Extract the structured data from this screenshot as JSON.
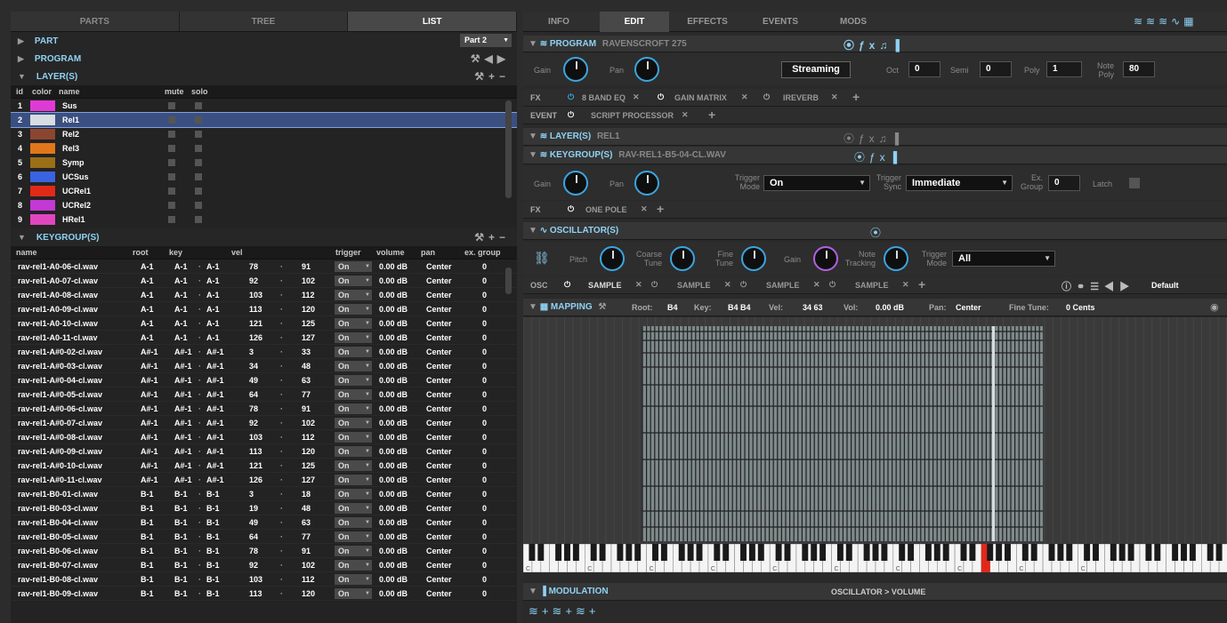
{
  "left_tabs": [
    "PARTS",
    "TREE",
    "LIST"
  ],
  "part": {
    "label": "PART",
    "selector": "Part 2"
  },
  "program_label": "PROGRAM",
  "layers": {
    "label": "LAYER(S)",
    "headers": [
      "id",
      "color",
      "name",
      "mute",
      "solo"
    ],
    "rows": [
      {
        "id": "1",
        "name": "Sus",
        "color": "#e03ad6"
      },
      {
        "id": "2",
        "name": "Rel1",
        "color": "#d7dde0"
      },
      {
        "id": "3",
        "name": "Rel2",
        "color": "#8a4630"
      },
      {
        "id": "4",
        "name": "Rel3",
        "color": "#e2761a"
      },
      {
        "id": "5",
        "name": "Symp",
        "color": "#9b6f15"
      },
      {
        "id": "6",
        "name": "UCSus",
        "color": "#3a63e0"
      },
      {
        "id": "7",
        "name": "UCRel1",
        "color": "#e02a18"
      },
      {
        "id": "8",
        "name": "UCRel2",
        "color": "#c438d4"
      },
      {
        "id": "9",
        "name": "HRel1",
        "color": "#e046c0"
      }
    ]
  },
  "keygroups": {
    "label": "KEYGROUP(S)",
    "headers": [
      "name",
      "root",
      "key",
      "vel",
      "trigger",
      "volume",
      "pan",
      "ex. group"
    ],
    "rows": [
      [
        "rav-rel1-A0-06-cl.wav",
        "A-1",
        "A-1",
        "A-1",
        "78",
        "91",
        "On",
        "0.00 dB",
        "Center",
        "0"
      ],
      [
        "rav-rel1-A0-07-cl.wav",
        "A-1",
        "A-1",
        "A-1",
        "92",
        "102",
        "On",
        "0.00 dB",
        "Center",
        "0"
      ],
      [
        "rav-rel1-A0-08-cl.wav",
        "A-1",
        "A-1",
        "A-1",
        "103",
        "112",
        "On",
        "0.00 dB",
        "Center",
        "0"
      ],
      [
        "rav-rel1-A0-09-cl.wav",
        "A-1",
        "A-1",
        "A-1",
        "113",
        "120",
        "On",
        "0.00 dB",
        "Center",
        "0"
      ],
      [
        "rav-rel1-A0-10-cl.wav",
        "A-1",
        "A-1",
        "A-1",
        "121",
        "125",
        "On",
        "0.00 dB",
        "Center",
        "0"
      ],
      [
        "rav-rel1-A0-11-cl.wav",
        "A-1",
        "A-1",
        "A-1",
        "126",
        "127",
        "On",
        "0.00 dB",
        "Center",
        "0"
      ],
      [
        "rav-rel1-A#0-02-cl.wav",
        "A#-1",
        "A#-1",
        "A#-1",
        "3",
        "33",
        "On",
        "0.00 dB",
        "Center",
        "0"
      ],
      [
        "rav-rel1-A#0-03-cl.wav",
        "A#-1",
        "A#-1",
        "A#-1",
        "34",
        "48",
        "On",
        "0.00 dB",
        "Center",
        "0"
      ],
      [
        "rav-rel1-A#0-04-cl.wav",
        "A#-1",
        "A#-1",
        "A#-1",
        "49",
        "63",
        "On",
        "0.00 dB",
        "Center",
        "0"
      ],
      [
        "rav-rel1-A#0-05-cl.wav",
        "A#-1",
        "A#-1",
        "A#-1",
        "64",
        "77",
        "On",
        "0.00 dB",
        "Center",
        "0"
      ],
      [
        "rav-rel1-A#0-06-cl.wav",
        "A#-1",
        "A#-1",
        "A#-1",
        "78",
        "91",
        "On",
        "0.00 dB",
        "Center",
        "0"
      ],
      [
        "rav-rel1-A#0-07-cl.wav",
        "A#-1",
        "A#-1",
        "A#-1",
        "92",
        "102",
        "On",
        "0.00 dB",
        "Center",
        "0"
      ],
      [
        "rav-rel1-A#0-08-cl.wav",
        "A#-1",
        "A#-1",
        "A#-1",
        "103",
        "112",
        "On",
        "0.00 dB",
        "Center",
        "0"
      ],
      [
        "rav-rel1-A#0-09-cl.wav",
        "A#-1",
        "A#-1",
        "A#-1",
        "113",
        "120",
        "On",
        "0.00 dB",
        "Center",
        "0"
      ],
      [
        "rav-rel1-A#0-10-cl.wav",
        "A#-1",
        "A#-1",
        "A#-1",
        "121",
        "125",
        "On",
        "0.00 dB",
        "Center",
        "0"
      ],
      [
        "rav-rel1-A#0-11-cl.wav",
        "A#-1",
        "A#-1",
        "A#-1",
        "126",
        "127",
        "On",
        "0.00 dB",
        "Center",
        "0"
      ],
      [
        "rav-rel1-B0-01-cl.wav",
        "B-1",
        "B-1",
        "B-1",
        "3",
        "18",
        "On",
        "0.00 dB",
        "Center",
        "0"
      ],
      [
        "rav-rel1-B0-03-cl.wav",
        "B-1",
        "B-1",
        "B-1",
        "19",
        "48",
        "On",
        "0.00 dB",
        "Center",
        "0"
      ],
      [
        "rav-rel1-B0-04-cl.wav",
        "B-1",
        "B-1",
        "B-1",
        "49",
        "63",
        "On",
        "0.00 dB",
        "Center",
        "0"
      ],
      [
        "rav-rel1-B0-05-cl.wav",
        "B-1",
        "B-1",
        "B-1",
        "64",
        "77",
        "On",
        "0.00 dB",
        "Center",
        "0"
      ],
      [
        "rav-rel1-B0-06-cl.wav",
        "B-1",
        "B-1",
        "B-1",
        "78",
        "91",
        "On",
        "0.00 dB",
        "Center",
        "0"
      ],
      [
        "rav-rel1-B0-07-cl.wav",
        "B-1",
        "B-1",
        "B-1",
        "92",
        "102",
        "On",
        "0.00 dB",
        "Center",
        "0"
      ],
      [
        "rav-rel1-B0-08-cl.wav",
        "B-1",
        "B-1",
        "B-1",
        "103",
        "112",
        "On",
        "0.00 dB",
        "Center",
        "0"
      ],
      [
        "rav-rel1-B0-09-cl.wav",
        "B-1",
        "B-1",
        "B-1",
        "113",
        "120",
        "On",
        "0.00 dB",
        "Center",
        "0"
      ]
    ]
  },
  "right_tabs": [
    "INFO",
    "EDIT",
    "EFFECTS",
    "EVENTS",
    "MODS"
  ],
  "program": {
    "label": "PROGRAM",
    "name": "RAVENSCROFT 275",
    "gain": "Gain",
    "pan": "Pan",
    "streaming": "Streaming",
    "oct_label": "Oct",
    "oct": "0",
    "semi_label": "Semi",
    "semi": "0",
    "poly_label": "Poly",
    "poly": "1",
    "notepoly_label": "Note Poly",
    "notepoly": "80"
  },
  "fx_label": "FX",
  "event_label": "EVENT",
  "program_fx": [
    "8 BAND EQ",
    "GAIN MATRIX",
    "IREVERB"
  ],
  "program_event": [
    "SCRIPT PROCESSOR"
  ],
  "layer_bar": {
    "label": "LAYER(S)",
    "name": "REL1"
  },
  "keygroup_bar": {
    "label": "KEYGROUP(S)",
    "name": "RAV-REL1-B5-04-CL.WAV",
    "gain": "Gain",
    "pan": "Pan",
    "trigger_mode_label": "Trigger Mode",
    "trigger_mode": "On",
    "trigger_sync_label": "Trigger Sync",
    "trigger_sync": "Immediate",
    "exgroup_label": "Ex. Group",
    "exgroup": "0",
    "latch": "Latch"
  },
  "keygroup_fx": [
    "ONE POLE"
  ],
  "osc": {
    "label": "OSCILLATOR(S)",
    "pitch": "Pitch",
    "coarse": "Coarse Tune",
    "fine": "Fine Tune",
    "gain": "Gain",
    "note_tracking": "Note Tracking",
    "trigger_mode_label": "Trigger Mode",
    "trigger_mode": "All",
    "osc_label": "OSC",
    "samples": [
      "SAMPLE",
      "SAMPLE",
      "SAMPLE",
      "SAMPLE"
    ],
    "preset": "Default"
  },
  "mapping": {
    "label": "MAPPING",
    "root_label": "Root:",
    "root": "B4",
    "key_label": "Key:",
    "key": "B4 B4",
    "vel_label": "Vel:",
    "vel": "34 63",
    "vol_label": "Vol:",
    "vol": "0.00 dB",
    "pan_label": "Pan:",
    "pan": "Center",
    "fine_label": "Fine Tune:",
    "fine": "0 Cents",
    "octave_marks": [
      "C",
      "C",
      "C",
      "C",
      "C",
      "C",
      "C",
      "C",
      "C",
      "C"
    ]
  },
  "modulation": {
    "label": "MODULATION",
    "target": "OSCILLATOR > VOLUME"
  },
  "colors": {
    "accent": "#8fd2f5",
    "knob": "#3aa6e0",
    "selected": "#3b4f80",
    "key_highlight": "#e0281a"
  }
}
